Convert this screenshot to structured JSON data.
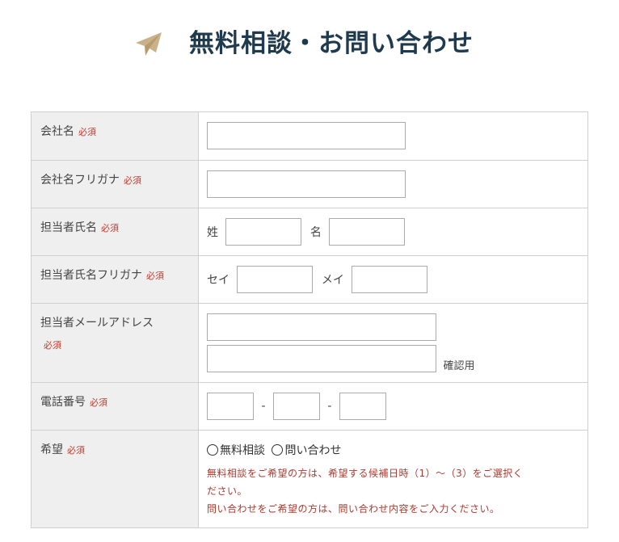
{
  "header": {
    "title": "無料相談・お問い合わせ",
    "icon": "paper-plane-icon",
    "icon_color": "#c9b28a",
    "title_color": "#1f3a4d"
  },
  "required_label": "必須",
  "required_color": "#c0392b",
  "fields": {
    "company": {
      "label": "会社名"
    },
    "company_kana": {
      "label": "会社名フリガナ"
    },
    "contact_name": {
      "label": "担当者氏名",
      "sei_label": "姓",
      "mei_label": "名"
    },
    "contact_kana": {
      "label": "担当者氏名フリガナ",
      "sei_label": "セイ",
      "mei_label": "メイ"
    },
    "email": {
      "label": "担当者メールアドレス",
      "confirm_label": "確認用"
    },
    "phone": {
      "label": "電話番号",
      "separator": "-"
    },
    "request": {
      "label": "希望",
      "options": [
        "無料相談",
        "問い合わせ"
      ],
      "note_line1": "無料相談をご希望の方は、希望する候補日時（1）～（3）をご選択く",
      "note_line2": "ださい。",
      "note_line3": "問い合わせをご希望の方は、問い合わせ内容をご入力ください。"
    }
  }
}
